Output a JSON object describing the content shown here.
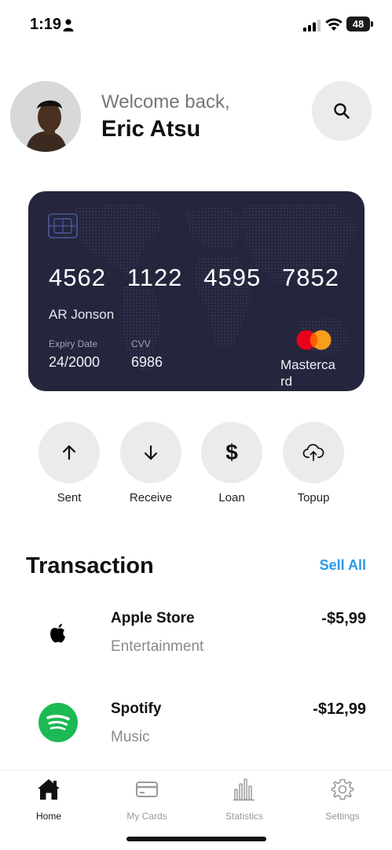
{
  "status_bar": {
    "time": "1:19",
    "battery": "48"
  },
  "header": {
    "greeting": "Welcome back,",
    "user_name": "Eric Atsu"
  },
  "card": {
    "number_groups": [
      "4562",
      "1122",
      "4595",
      "7852"
    ],
    "holder": "AR Jonson",
    "expiry_label": "Expiry Date",
    "expiry_value": "24/2000",
    "cvv_label": "CVV",
    "cvv_value": "6986",
    "brand": "Mastercard",
    "colors": {
      "background": "#25253d",
      "logo_red": "#eb001b",
      "logo_orange": "#f79e1b"
    }
  },
  "actions": [
    {
      "label": "Sent",
      "icon": "arrow-up-icon"
    },
    {
      "label": "Receive",
      "icon": "arrow-down-icon"
    },
    {
      "label": "Loan",
      "icon": "dollar-icon"
    },
    {
      "label": "Topup",
      "icon": "cloud-upload-icon"
    }
  ],
  "transactions": {
    "title": "Transaction",
    "see_all": "Sell All",
    "items": [
      {
        "name": "Apple Store",
        "category": "Entertainment",
        "amount": "-$5,99",
        "icon": "apple-icon"
      },
      {
        "name": "Spotify",
        "category": "Music",
        "amount": "-$12,99",
        "icon": "spotify-icon"
      }
    ]
  },
  "bottom_nav": {
    "items": [
      {
        "label": "Home",
        "icon": "home-icon",
        "active": true
      },
      {
        "label": "My Cards",
        "icon": "card-icon",
        "active": false
      },
      {
        "label": "Statistics",
        "icon": "bar-chart-icon",
        "active": false
      },
      {
        "label": "Settings",
        "icon": "gear-icon",
        "active": false
      }
    ]
  },
  "colors": {
    "accent_link": "#2b98e8",
    "spotify_green": "#1db954",
    "button_bg": "#ebebeb"
  }
}
